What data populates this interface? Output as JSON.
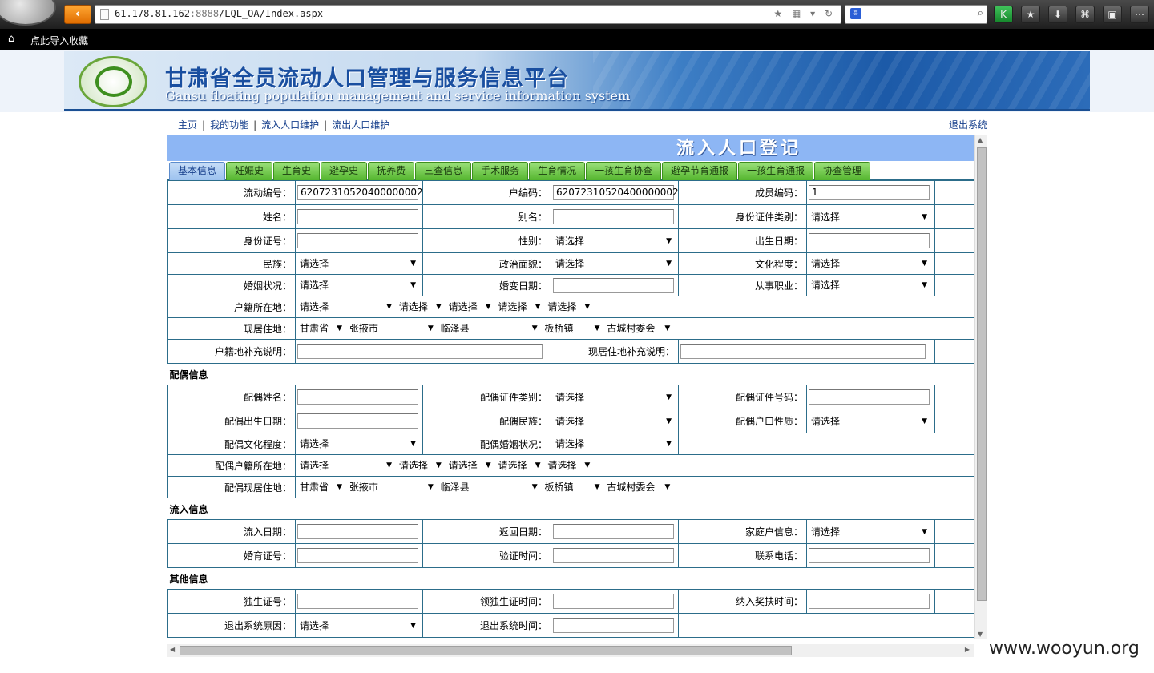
{
  "browser": {
    "url_host": "61.178.81.162",
    "url_port": ":8888",
    "url_path": "/LQL_OA/Index.aspx",
    "url_icons": "★ ▦ ▾ ↻",
    "search_icon": "⌕",
    "paw_icon": "ʬ",
    "toolbar": [
      "K",
      "★",
      "⬇",
      "⌘",
      "▣",
      "⋯"
    ],
    "bookmark_text": "点此导入收藏",
    "home_icon": "⌂"
  },
  "banner": {
    "title": "甘肃省全员流动人口管理与服务信息平台",
    "subtitle": "Gansu floating population management and service information system"
  },
  "nav": {
    "items": [
      "主页",
      "我的功能",
      "流入人口维护",
      "流出人口维护"
    ],
    "logout": "退出系统"
  },
  "form": {
    "title": "流入人口登记",
    "tabs": [
      "基本信息",
      "妊娠史",
      "生育史",
      "避孕史",
      "抚养费",
      "三查信息",
      "手术服务",
      "生育情况",
      "一孩生育协查",
      "避孕节育通报",
      "一孩生育通报",
      "协查管理"
    ],
    "active_tab": "基本信息",
    "select_default": "请选择",
    "fields": {
      "floating_no": {
        "label": "流动编号：",
        "value": "62072310520400000002"
      },
      "household_no": {
        "label": "户编码：",
        "value": "62072310520400000002"
      },
      "member_no": {
        "label": "成员编码：",
        "value": "1"
      },
      "name": {
        "label": "姓名："
      },
      "alias": {
        "label": "别名："
      },
      "id_type": {
        "label": "身份证件类别："
      },
      "id_no": {
        "label": "身份证号："
      },
      "gender": {
        "label": "性别："
      },
      "birth_date": {
        "label": "出生日期："
      },
      "ethnicity": {
        "label": "民族："
      },
      "political": {
        "label": "政治面貌："
      },
      "education": {
        "label": "文化程度："
      },
      "marital": {
        "label": "婚姻状况："
      },
      "marital_change": {
        "label": "婚变日期："
      },
      "occupation": {
        "label": "从事职业："
      },
      "hukou_place": {
        "label": "户籍所在地："
      },
      "residence": {
        "label": "现居住地：",
        "values": [
          "甘肃省",
          "张掖市",
          "临泽县",
          "板桥镇",
          "古城村委会"
        ]
      },
      "hukou_note": {
        "label": "户籍地补充说明："
      },
      "residence_note": {
        "label": "现居住地补充说明："
      }
    },
    "sections": {
      "spouse": "配偶信息",
      "inflow": "流入信息",
      "other": "其他信息"
    },
    "spouse": {
      "name": "配偶姓名：",
      "id_type": "配偶证件类别：",
      "id_no": "配偶证件号码：",
      "birth_date": "配偶出生日期：",
      "ethnicity": "配偶民族：",
      "hukou_type": "配偶户口性质：",
      "education": "配偶文化程度：",
      "marital": "配偶婚姻状况：",
      "hukou_place": "配偶户籍所在地：",
      "residence": "配偶现居住地："
    },
    "inflow": {
      "inflow_date": "流入日期：",
      "return_date": "返回日期：",
      "family_info": "家庭户信息：",
      "marriage_cert": "婚育证号：",
      "verify_time": "验证时间：",
      "phone": "联系电话："
    },
    "other": {
      "only_child_cert": "独生证号：",
      "only_child_time": "领独生证时间：",
      "subsidy_time": "纳入奖扶时间：",
      "exit_reason": "退出系统原因：",
      "exit_time": "退出系统时间："
    }
  },
  "watermark": "www.wooyun.org",
  "scroll": {
    "up": "▲",
    "down": "▼",
    "left": "◀",
    "right": "▶"
  }
}
